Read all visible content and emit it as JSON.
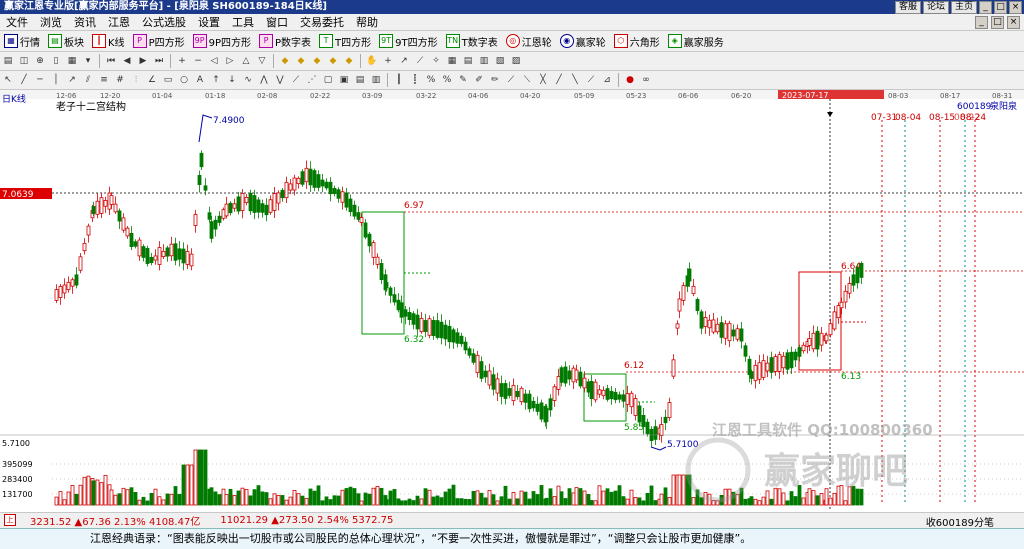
{
  "app": {
    "title": "赢家江恩专业版[赢家内部服务平台] - [泉阳泉  SH600189-184日K线]",
    "right_buttons": [
      "客服",
      "论坛",
      "主页"
    ]
  },
  "menu": [
    "文件",
    "浏览",
    "资讯",
    "江恩",
    "公式选股",
    "设置",
    "工具",
    "窗口",
    "交易委托",
    "帮助"
  ],
  "toolbar1": [
    "行情",
    "板块",
    "K线",
    "P四方形",
    "9P四方形",
    "P数字表",
    "T四方形",
    "9T四方形",
    "T数字表",
    "江恩轮",
    "赢家轮",
    "六角形",
    "赢家服务"
  ],
  "chart_header": {
    "period": "日K线",
    "structure": "老子十二宫结构",
    "stock_code": "600189",
    "stock_name": "泉阳泉",
    "cursor_date": "2023-07-17",
    "price_label": "7.0639"
  },
  "time_axis": [
    "12-06",
    "12-20",
    "01-04",
    "01-18",
    "02-08",
    "02-22",
    "03-09",
    "03-22",
    "04-06",
    "04-20",
    "05-09",
    "05-23",
    "06-06",
    "06-20",
    "07-06",
    "08-03",
    "08-17",
    "08-31"
  ],
  "annotations": {
    "high": "7.4900",
    "low": "5.7100",
    "box1_top": "6.97",
    "box1_bot": "6.32",
    "box2_top": "6.12",
    "box2_bot": "5.85",
    "box3_top": "6.64",
    "box3_bot": "6.13",
    "future_dates": [
      "07-31",
      "08-04",
      "08-15",
      "08-24",
      "08-22"
    ]
  },
  "volume_axis": [
    "5.7100",
    "395099",
    "283400",
    "131700"
  ],
  "watermark": {
    "line1": "江恩工具软件  QQ:100800360",
    "line2": "赢家聊吧"
  },
  "status": {
    "sh": "3231.52 ▲67.36 2.13% 4108.47亿",
    "sz": "11021.29 ▲273.50 2.54% 5372.75",
    "right": "收600189分笔"
  },
  "quote": "江恩经典语录：“图表能反映出一切股市或公司股民的总体心理状况”，“不要一次性买进，傲慢就是罪过”，“调整只会让股市更加健康”。",
  "colors": {
    "up": "#d00000",
    "down": "#007a00",
    "title_bg": "#1c3a8c"
  }
}
